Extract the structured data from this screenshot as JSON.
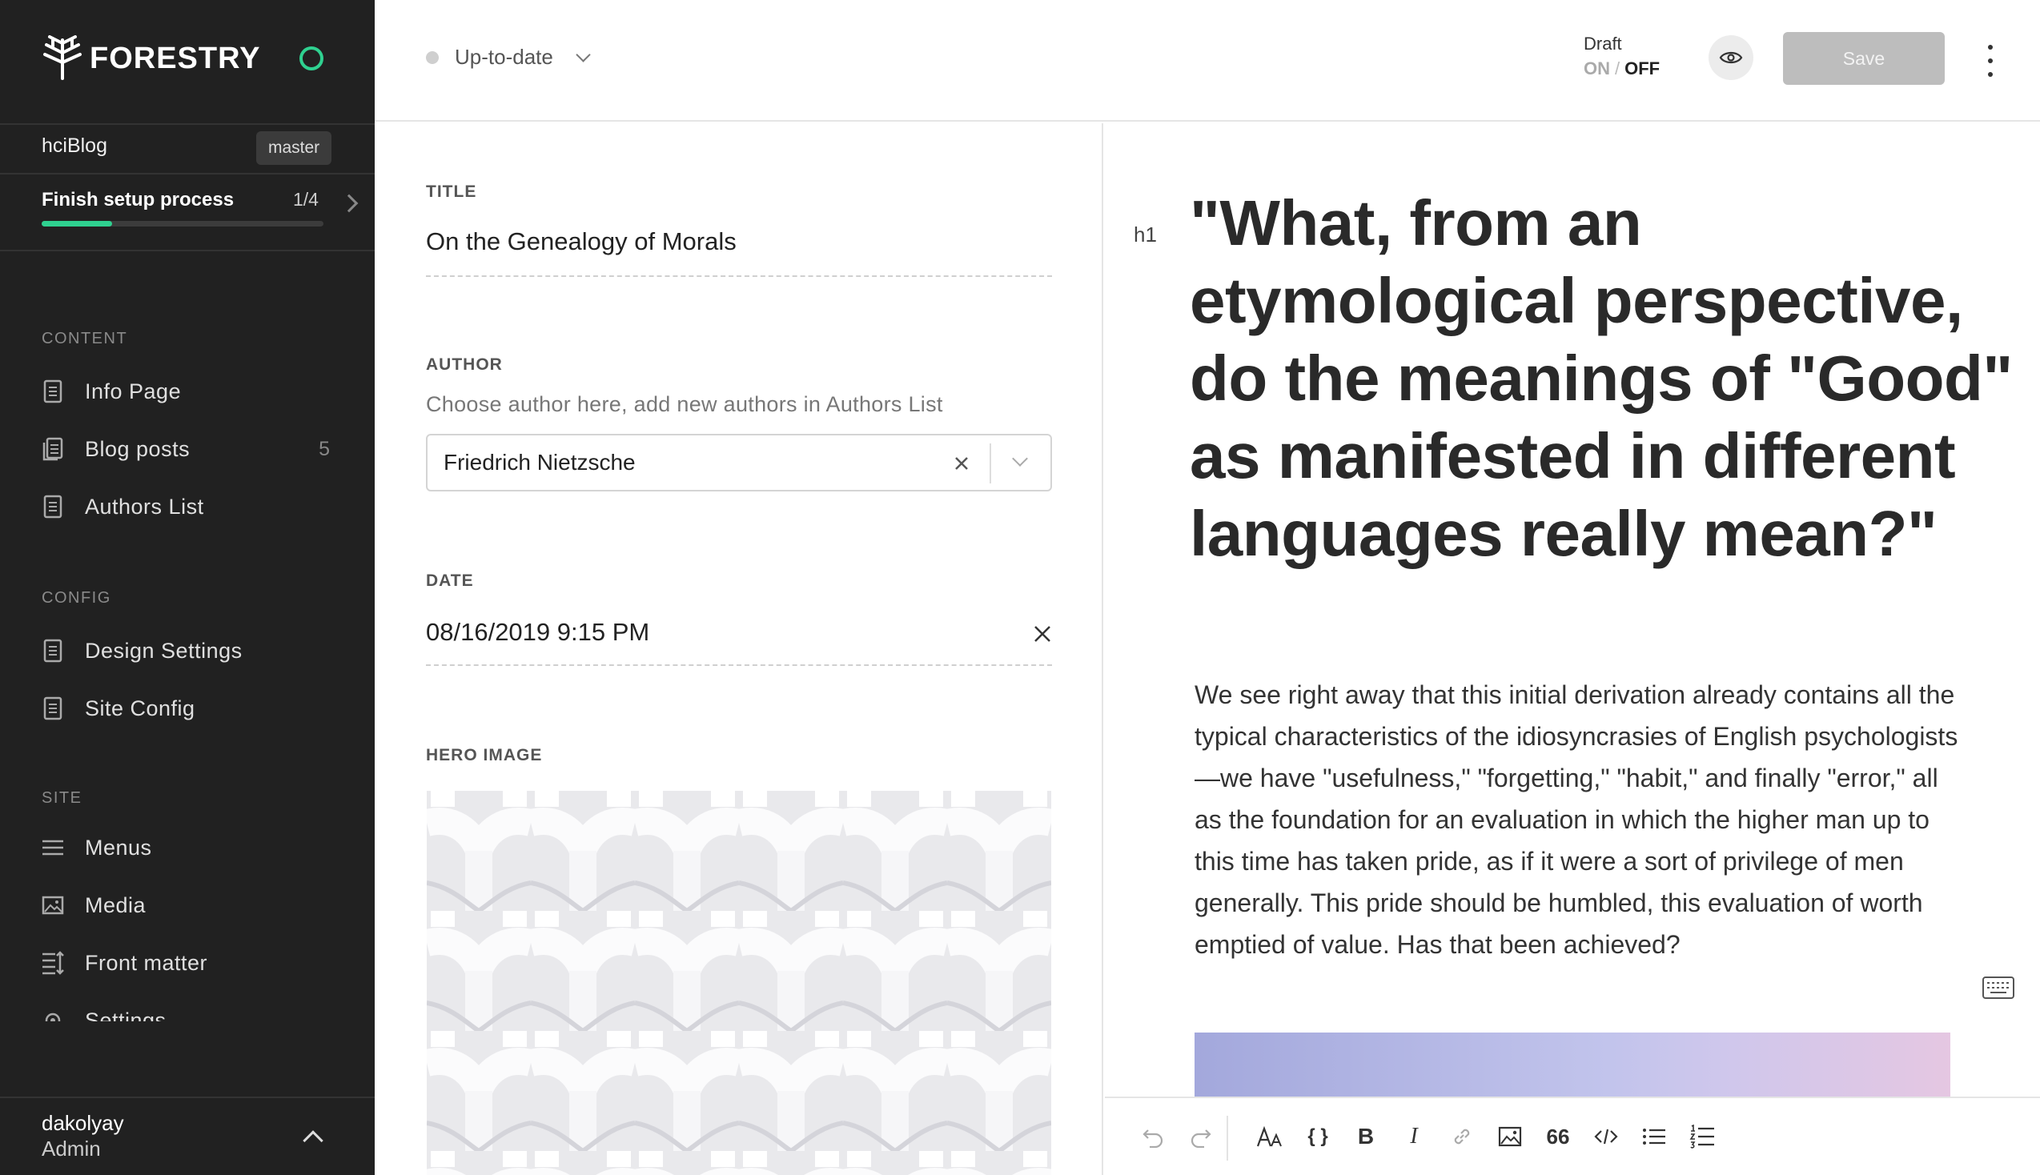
{
  "app": {
    "brand": "FORESTRY",
    "site_name": "hciBlog",
    "branch": "master",
    "accent": "#2fd190"
  },
  "setup": {
    "label": "Finish setup process",
    "count": "1/4",
    "progress": 0.25
  },
  "sidebar": {
    "sections": [
      {
        "label": "CONTENT",
        "items": [
          {
            "label": "Info Page",
            "icon": "document-icon"
          },
          {
            "label": "Blog posts",
            "icon": "documents-icon",
            "count": "5"
          },
          {
            "label": "Authors List",
            "icon": "document-icon"
          }
        ]
      },
      {
        "label": "CONFIG",
        "items": [
          {
            "label": "Design Settings",
            "icon": "document-icon"
          },
          {
            "label": "Site Config",
            "icon": "document-icon"
          }
        ]
      },
      {
        "label": "SITE",
        "items": [
          {
            "label": "Menus",
            "icon": "menu-icon"
          },
          {
            "label": "Media",
            "icon": "image-icon"
          },
          {
            "label": "Front matter",
            "icon": "front-matter-icon"
          },
          {
            "label": "Settings",
            "icon": "settings-icon"
          }
        ]
      }
    ]
  },
  "user": {
    "name": "dakolyay",
    "role": "Admin"
  },
  "topbar": {
    "sync_status": "Up-to-date",
    "draft_label": "Draft",
    "draft_on": "ON",
    "draft_sep": "/",
    "draft_off": "OFF",
    "save_label": "Save"
  },
  "form": {
    "title": {
      "label": "TITLE",
      "value": "On the Genealogy of Morals"
    },
    "author": {
      "label": "AUTHOR",
      "help": "Choose author here, add new authors in Authors List",
      "value": "Friedrich Nietzsche"
    },
    "date": {
      "label": "DATE",
      "value": "08/16/2019 9:15 PM"
    },
    "hero": {
      "label": "HERO IMAGE"
    }
  },
  "editor": {
    "block_marker": "h1",
    "heading": "\"What, from an etymological perspective, do the meanings of \"Good\" as manifested in different languages really mean?\"",
    "paragraph": "We see right away that this initial derivation already contains all the typical characteristics of the idiosyncrasies of English psychologists—we have \"usefulness,\" \"forgetting,\" \"habit,\" and finally \"error,\" all as the foundation for an evaluation in which the higher man up to this time has taken pride, as if it were a sort of privilege of men generally. This pride should be humbled, this evaluation of worth emptied of value. Has that been achieved?",
    "toolbar": {
      "quote_glyph": "66",
      "code_glyph": "{ }",
      "bold_glyph": "B",
      "italic_glyph": "I"
    }
  }
}
